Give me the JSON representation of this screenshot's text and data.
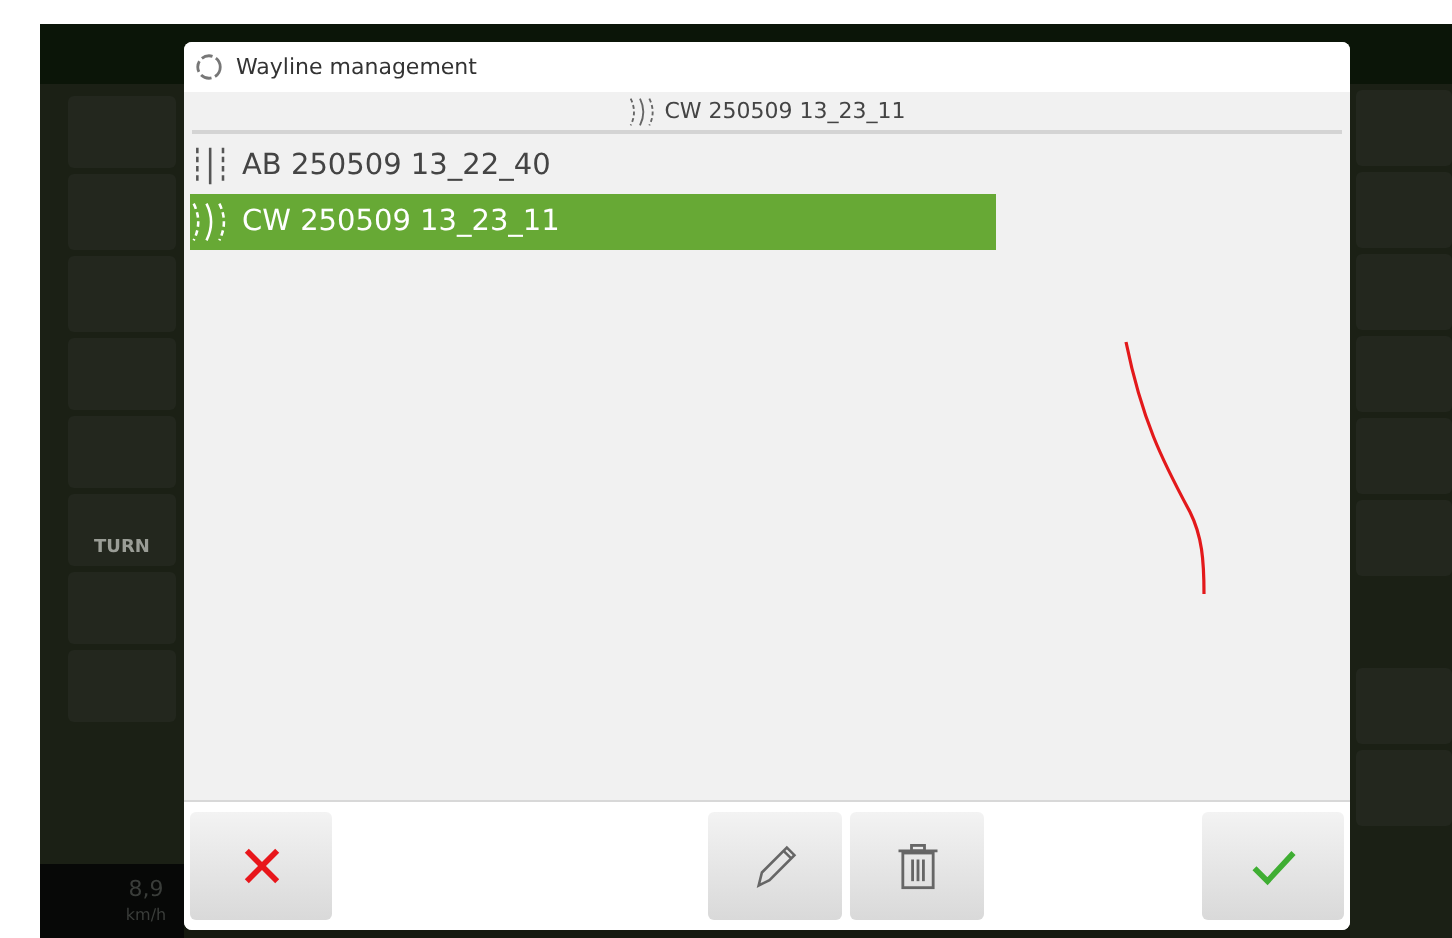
{
  "background": {
    "turn_label": "TURN",
    "speed": "8,9",
    "speed_unit": "km/h"
  },
  "dialog": {
    "title": "Wayline management",
    "current": {
      "kind": "cw",
      "name": "CW 250509 13_23_11"
    },
    "waylines": [
      {
        "kind": "ab",
        "name": "AB 250509 13_22_40",
        "selected": false
      },
      {
        "kind": "cw",
        "name": "CW 250509 13_23_11",
        "selected": true
      }
    ],
    "buttons": [
      {
        "kind": "cancel"
      },
      {
        "kind": "edit"
      },
      {
        "kind": "delete"
      },
      {
        "kind": "confirm"
      }
    ]
  }
}
